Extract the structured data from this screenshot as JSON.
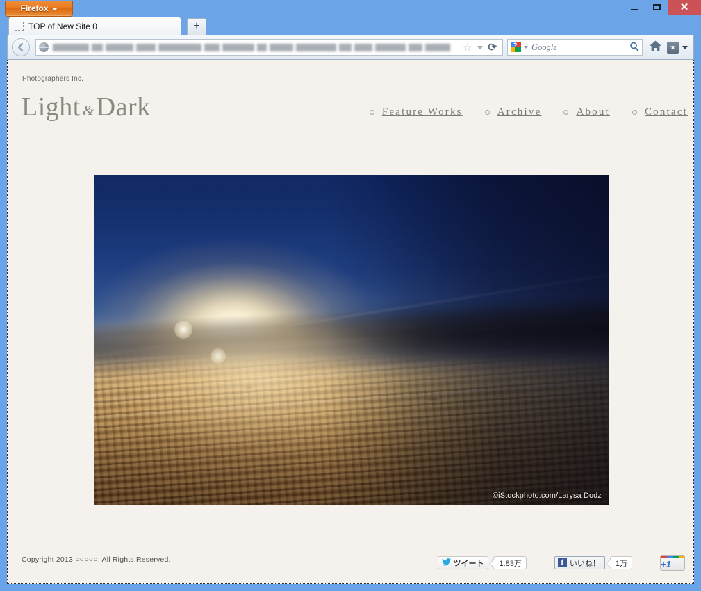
{
  "browser": {
    "app_button_label": "Firefox",
    "tab": {
      "title": "TOP of New Site 0",
      "favicon": "blank-page-icon"
    },
    "new_tab_label": "+",
    "back_icon": "back-arrow-icon",
    "url_value": "",
    "site_identity_icon": "globe-icon",
    "star_icon": "☆",
    "dropdown_icon": "chevron-down-icon",
    "reload_icon": "⟳",
    "search": {
      "engine": "Google",
      "placeholder": "Google",
      "engine_icon": "google-g-icon",
      "submit_icon": "magnifier-icon"
    },
    "home_icon": "home-icon",
    "bookmarks_icon": "bookmark-star-icon",
    "window_controls": {
      "minimize": "minimize-icon",
      "maximize": "maximize-icon",
      "close": "✕"
    }
  },
  "page": {
    "site_subtitle": "Photographers Inc.",
    "logo": {
      "first": "Light",
      "amp": "&",
      "second": "Dark"
    },
    "nav": [
      {
        "label": "Feature Works"
      },
      {
        "label": "Archive"
      },
      {
        "label": "About"
      },
      {
        "label": "Contact"
      }
    ],
    "hero": {
      "alt": "Sunrise above the cloud deck seen from an airplane",
      "watermark": "©iStockphoto.com/Larysa Dodz"
    },
    "footer": {
      "copyright": "Copyright 2013 ○○○○○. All Rights Reserved.",
      "social": {
        "twitter": {
          "label": "ツイート",
          "count": "1.83万",
          "icon": "twitter-bird-icon"
        },
        "facebook": {
          "label": "いいね！",
          "count": "1万",
          "icon": "facebook-f-icon"
        },
        "googleplus": {
          "label": "+1",
          "icon": "google-plus-one-icon"
        }
      }
    },
    "colors": {
      "page_background": "#f5f2ed",
      "logo_text": "#8b8880",
      "nav_text": "#7e7b74",
      "footer_text": "#55524c"
    }
  }
}
